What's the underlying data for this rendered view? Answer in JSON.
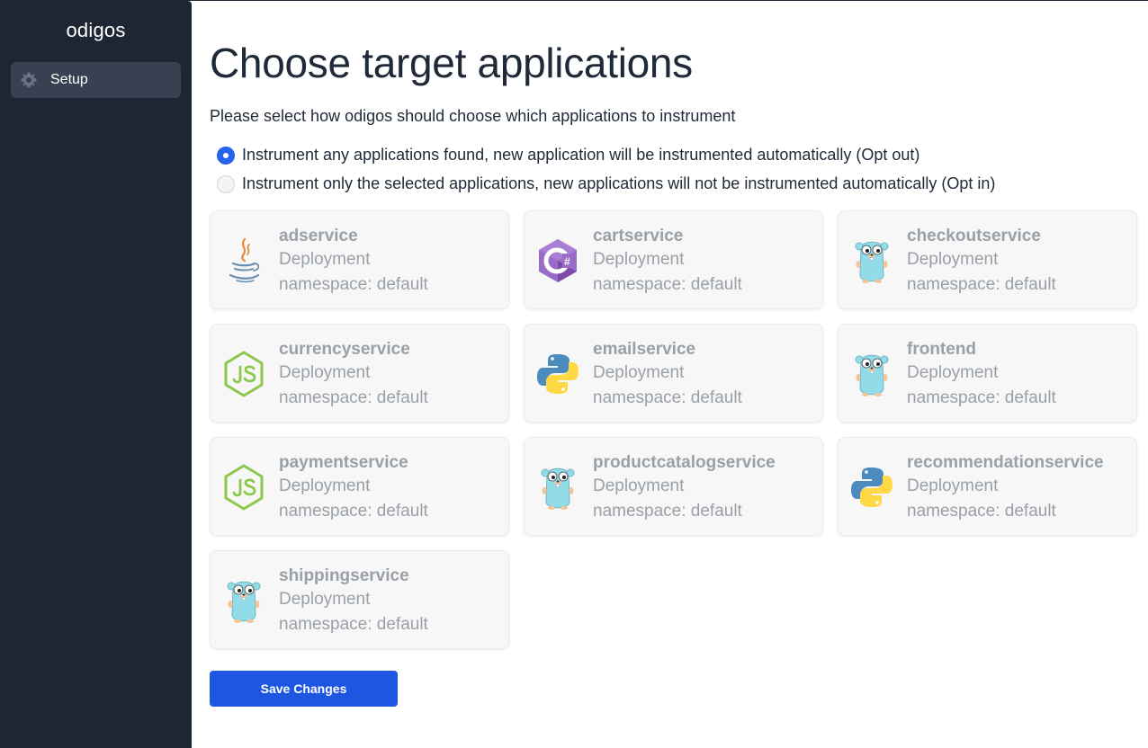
{
  "sidebar": {
    "brand": "odigos",
    "items": [
      {
        "label": "Setup",
        "icon": "gear-icon"
      }
    ]
  },
  "main": {
    "title": "Choose target applications",
    "subtitle": "Please select how odigos should choose which applications to instrument",
    "options": [
      {
        "label": "Instrument any applications found, new application will be instrumented automatically (Opt out)",
        "checked": true
      },
      {
        "label": "Instrument only the selected applications, new applications will not be instrumented automatically (Opt in)",
        "checked": false
      }
    ],
    "apps": [
      {
        "name": "adservice",
        "kind": "Deployment",
        "namespace": "namespace: default",
        "language": "java-icon"
      },
      {
        "name": "cartservice",
        "kind": "Deployment",
        "namespace": "namespace: default",
        "language": "csharp-icon"
      },
      {
        "name": "checkoutservice",
        "kind": "Deployment",
        "namespace": "namespace: default",
        "language": "go-gopher-icon"
      },
      {
        "name": "currencyservice",
        "kind": "Deployment",
        "namespace": "namespace: default",
        "language": "nodejs-icon"
      },
      {
        "name": "emailservice",
        "kind": "Deployment",
        "namespace": "namespace: default",
        "language": "python-icon"
      },
      {
        "name": "frontend",
        "kind": "Deployment",
        "namespace": "namespace: default",
        "language": "go-gopher-icon"
      },
      {
        "name": "paymentservice",
        "kind": "Deployment",
        "namespace": "namespace: default",
        "language": "nodejs-icon"
      },
      {
        "name": "productcatalogservice",
        "kind": "Deployment",
        "namespace": "namespace: default",
        "language": "go-gopher-icon"
      },
      {
        "name": "recommendationservice",
        "kind": "Deployment",
        "namespace": "namespace: default",
        "language": "python-icon"
      },
      {
        "name": "shippingservice",
        "kind": "Deployment",
        "namespace": "namespace: default",
        "language": "go-gopher-icon"
      }
    ],
    "save_label": "Save Changes"
  },
  "colors": {
    "sidebar_bg": "#1f2633",
    "active_item_bg": "#374151",
    "accent": "#1d56e0",
    "card_text": "#9aa0a8"
  }
}
